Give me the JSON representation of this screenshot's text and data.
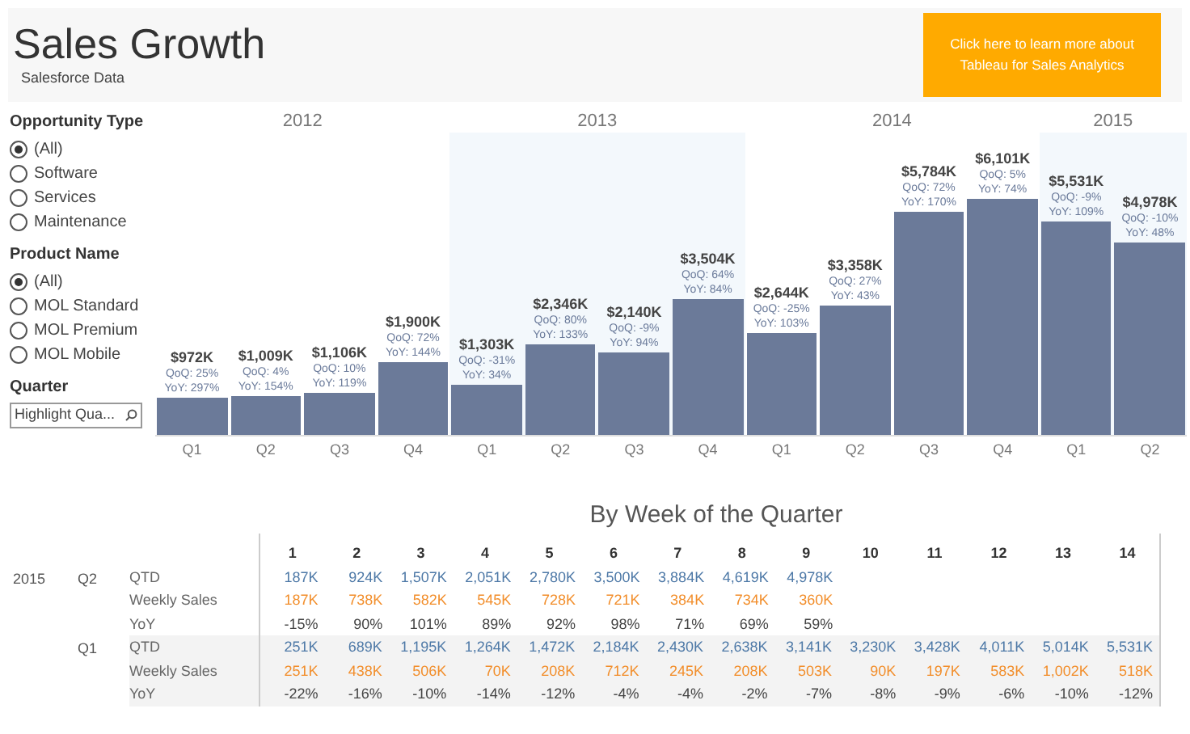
{
  "header": {
    "title": "Sales Growth",
    "subtitle": "Salesforce Data",
    "cta_button": "Click here to learn more about Tableau for Sales Analytics"
  },
  "filters": [
    {
      "kind": "radio",
      "title": "Opportunity Type",
      "options": [
        {
          "label": "(All)",
          "selected": true
        },
        {
          "label": "Software",
          "selected": false
        },
        {
          "label": "Services",
          "selected": false
        },
        {
          "label": "Maintenance",
          "selected": false
        }
      ]
    },
    {
      "kind": "radio",
      "title": "Product Name",
      "options": [
        {
          "label": "(All)",
          "selected": true
        },
        {
          "label": "MOL Standard",
          "selected": false
        },
        {
          "label": "MOL Premium",
          "selected": false
        },
        {
          "label": "MOL Mobile",
          "selected": false
        }
      ]
    },
    {
      "kind": "search",
      "title": "Quarter",
      "placeholder": "Highlight Qua..."
    }
  ],
  "chart": {
    "years": [
      {
        "label": "2012",
        "shaded": false,
        "quarters": [
          {
            "label": "Q1",
            "value": "$972K",
            "qoq": "QoQ: 25%",
            "yoy": "YoY: 297%"
          },
          {
            "label": "Q2",
            "value": "$1,009K",
            "qoq": "QoQ: 4%",
            "yoy": "YoY: 154%"
          },
          {
            "label": "Q3",
            "value": "$1,106K",
            "qoq": "QoQ: 10%",
            "yoy": "YoY: 119%"
          },
          {
            "label": "Q4",
            "value": "$1,900K",
            "qoq": "QoQ: 72%",
            "yoy": "YoY: 144%"
          }
        ]
      },
      {
        "label": "2013",
        "shaded": true,
        "quarters": [
          {
            "label": "Q1",
            "value": "$1,303K",
            "qoq": "QoQ: -31%",
            "yoy": "YoY: 34%"
          },
          {
            "label": "Q2",
            "value": "$2,346K",
            "qoq": "QoQ: 80%",
            "yoy": "YoY: 133%"
          },
          {
            "label": "Q3",
            "value": "$2,140K",
            "qoq": "QoQ: -9%",
            "yoy": "YoY: 94%"
          },
          {
            "label": "Q4",
            "value": "$3,504K",
            "qoq": "QoQ: 64%",
            "yoy": "YoY: 84%"
          }
        ]
      },
      {
        "label": "2014",
        "shaded": false,
        "quarters": [
          {
            "label": "Q1",
            "value": "$2,644K",
            "qoq": "QoQ: -25%",
            "yoy": "YoY: 103%"
          },
          {
            "label": "Q2",
            "value": "$3,358K",
            "qoq": "QoQ: 27%",
            "yoy": "YoY: 43%"
          },
          {
            "label": "Q3",
            "value": "$5,784K",
            "qoq": "QoQ: 72%",
            "yoy": "YoY: 170%"
          },
          {
            "label": "Q4",
            "value": "$6,101K",
            "qoq": "QoQ: 5%",
            "yoy": "YoY: 74%"
          }
        ]
      },
      {
        "label": "2015",
        "shaded": true,
        "quarters": [
          {
            "label": "Q1",
            "value": "$5,531K",
            "qoq": "QoQ: -9%",
            "yoy": "YoY: 109%"
          },
          {
            "label": "Q2",
            "value": "$4,978K",
            "qoq": "QoQ: -10%",
            "yoy": "YoY: 48%"
          }
        ]
      }
    ]
  },
  "weekly_table": {
    "title": "By Week of the Quarter",
    "columns": [
      "1",
      "2",
      "3",
      "4",
      "5",
      "6",
      "7",
      "8",
      "9",
      "10",
      "11",
      "12",
      "13",
      "14"
    ],
    "sections": [
      {
        "year": "2015",
        "quarter": "Q2",
        "shaded": false,
        "rows": [
          {
            "kind": "qtd",
            "label": "QTD",
            "values": [
              "187K",
              "924K",
              "1,507K",
              "2,051K",
              "2,780K",
              "3,500K",
              "3,884K",
              "4,619K",
              "4,978K"
            ]
          },
          {
            "kind": "weekly",
            "label": "Weekly Sales",
            "values": [
              "187K",
              "738K",
              "582K",
              "545K",
              "728K",
              "721K",
              "384K",
              "734K",
              "360K"
            ]
          },
          {
            "kind": "yoy",
            "label": "YoY",
            "values": [
              "-15%",
              "90%",
              "101%",
              "89%",
              "92%",
              "98%",
              "71%",
              "69%",
              "59%"
            ]
          }
        ]
      },
      {
        "quarter": "Q1",
        "shaded": true,
        "rows": [
          {
            "kind": "qtd",
            "label": "QTD",
            "values": [
              "251K",
              "689K",
              "1,195K",
              "1,264K",
              "1,472K",
              "2,184K",
              "2,430K",
              "2,638K",
              "3,141K",
              "3,230K",
              "3,428K",
              "4,011K",
              "5,014K",
              "5,531K"
            ]
          },
          {
            "kind": "weekly",
            "label": "Weekly Sales",
            "values": [
              "251K",
              "438K",
              "506K",
              "70K",
              "208K",
              "712K",
              "245K",
              "208K",
              "503K",
              "90K",
              "197K",
              "583K",
              "1,002K",
              "518K"
            ]
          },
          {
            "kind": "yoy",
            "label": "YoY",
            "values": [
              "-22%",
              "-16%",
              "-10%",
              "-14%",
              "-12%",
              "-4%",
              "-4%",
              "-2%",
              "-7%",
              "-8%",
              "-9%",
              "-6%",
              "-10%",
              "-12%"
            ]
          }
        ]
      }
    ]
  }
}
